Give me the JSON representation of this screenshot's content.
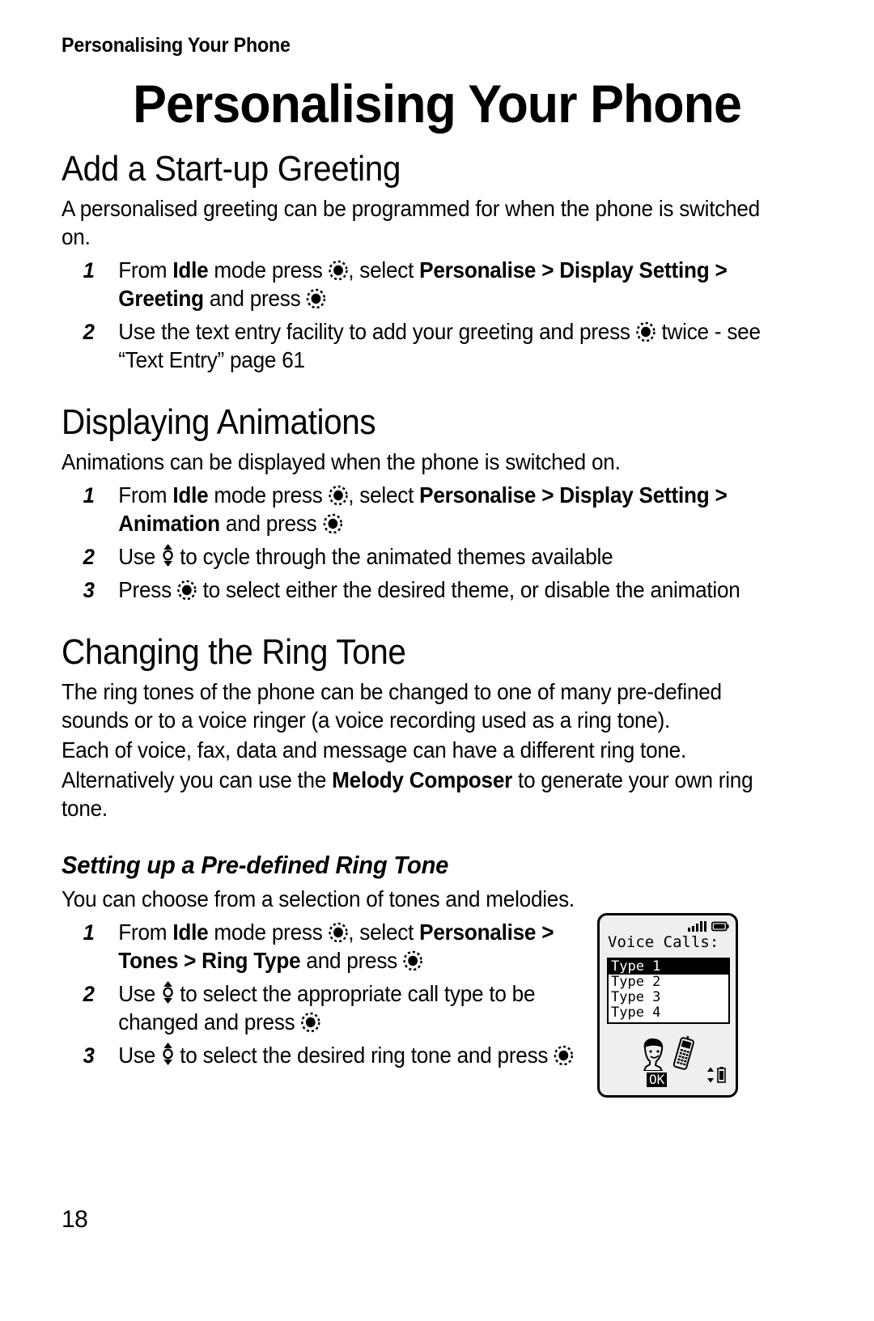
{
  "header": {
    "running_title": "Personalising Your Phone"
  },
  "title": "Personalising Your Phone",
  "sections": [
    {
      "heading": "Add a Start-up Greeting",
      "intro": "A personalised greeting can be programmed for when the phone is switched on.",
      "steps": [
        {
          "num": "1",
          "parts": [
            "From ",
            "Idle",
            " mode press ",
            "@select",
            ", select ",
            "Personalise > Display Setting > Greeting",
            " and press ",
            "@select"
          ]
        },
        {
          "num": "2",
          "parts": [
            "Use the text entry facility to add your greeting and press ",
            "@select",
            " twice - see “Text Entry” page 61"
          ]
        }
      ]
    },
    {
      "heading": "Displaying Animations",
      "intro": "Animations can be displayed when the phone is switched on.",
      "steps": [
        {
          "num": "1",
          "parts": [
            "From ",
            "Idle",
            " mode press ",
            "@select",
            ", select ",
            "Personalise > Display Setting > Animation",
            " and press ",
            "@select"
          ]
        },
        {
          "num": "2",
          "parts": [
            "Use ",
            "@updown",
            " to cycle through the animated themes available"
          ]
        },
        {
          "num": "3",
          "parts": [
            "Press ",
            "@select",
            " to select either the desired theme, or disable the animation"
          ]
        }
      ]
    },
    {
      "heading": "Changing the Ring Tone",
      "paragraphs": [
        "The ring tones of the phone can be changed to one of many pre-defined sounds or to a voice ringer (a voice recording used as a ring tone).",
        "Each of voice, fax, data and message can have a different ring tone.",
        "Alternatively you can use the Melody Composer to generate your own ring tone."
      ],
      "bold_in_paragraph_3": "Melody Composer",
      "subsection": {
        "heading": "Setting up a Pre-defined Ring Tone",
        "intro": "You can choose from a selection of tones and melodies.",
        "steps": [
          {
            "num": "1",
            "parts": [
              "From ",
              "Idle",
              " mode press ",
              "@select",
              ", select ",
              "Personalise > Tones > Ring Type",
              " and press ",
              "@select"
            ]
          },
          {
            "num": "2",
            "parts": [
              "Use ",
              "@updown",
              " to select the appropriate call type to be changed and press ",
              "@select"
            ]
          },
          {
            "num": "3",
            "parts": [
              "Use ",
              "@updown",
              " to select the desired ring tone and press ",
              "@select"
            ]
          }
        ]
      }
    }
  ],
  "body_text": {
    "s1_intro": "A personalised greeting can be programmed for when the phone is switched on.",
    "s1_step1_a": "From ",
    "s1_step1_b": "Idle",
    "s1_step1_c": " mode press ",
    "s1_step1_d": ", select ",
    "s1_step1_e": "Personalise > Display Setting > Greeting",
    "s1_step1_f": " and press ",
    "s1_step2_a": "Use the text entry facility to add your greeting and press ",
    "s1_step2_b": " twice - see “Text Entry” page 61",
    "s2_intro": "Animations can be displayed when the phone is switched on.",
    "s2_step1_e": "Personalise > Display Setting > Animation",
    "s2_step2_a": "Use ",
    "s2_step2_b": " to cycle through the animated themes available",
    "s2_step3_a": "Press ",
    "s2_step3_b": " to select either the desired theme, or disable the animation",
    "s3_p1": "The ring tones of the phone can be changed to one of many pre-defined sounds or to a voice ringer (a voice recording used as a ring tone).",
    "s3_p2": "Each of voice, fax, data and message can have a different ring tone.",
    "s3_p3_a": "Alternatively you can use the ",
    "s3_p3_b": "Melody Composer",
    "s3_p3_c": " to generate your own ring tone.",
    "s3_sub_intro": "You can choose from a selection of tones and melodies.",
    "s3_step1_e": "Personalise > Tones > Ring Type",
    "s3_step2_a": "Use ",
    "s3_step2_b": " to select the appropriate call type to be changed and press ",
    "s3_step3_a": "Use ",
    "s3_step3_b": " to select the desired ring tone and press "
  },
  "phone_screen": {
    "title": "Voice Calls:",
    "items": [
      "Type 1",
      "Type 2",
      "Type 3",
      "Type 4"
    ],
    "selected_index": 0,
    "softkey_left": "OK",
    "status_icons": [
      "signal-bars-icon",
      "battery-icon"
    ],
    "content_icons": [
      "face-icon",
      "mobile-phone-icon"
    ],
    "scroll_icons": [
      "up-down-arrows-icon",
      "battery-small-icon"
    ]
  },
  "icons": {
    "select_key": "select-key-icon",
    "up_down_key": "up-down-key-icon"
  },
  "page_number": "18"
}
